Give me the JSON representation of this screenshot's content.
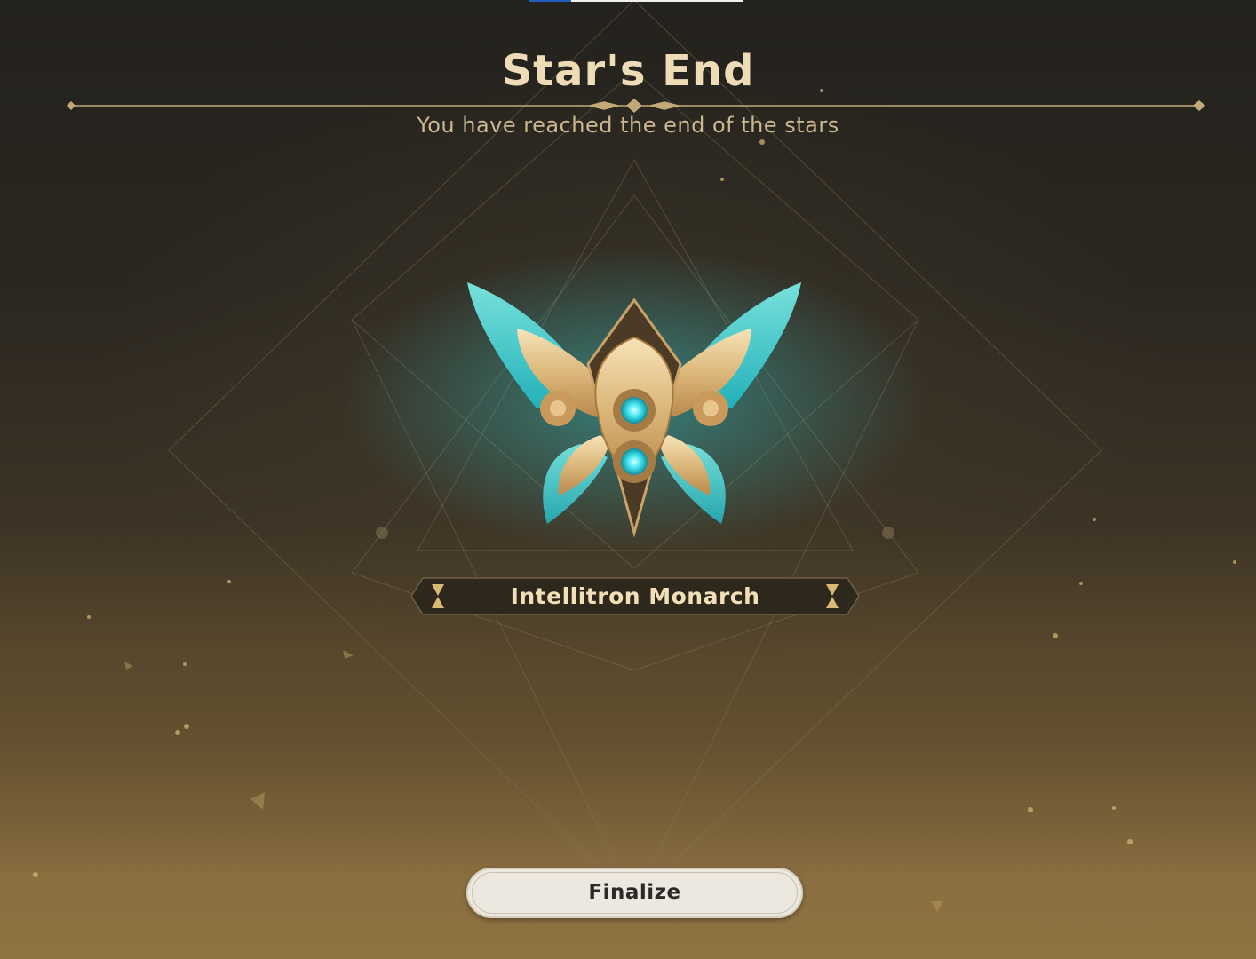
{
  "header": {
    "title": "Star's End",
    "subtitle": "You have reached the end of the stars"
  },
  "emblem": {
    "name": "Intellitron Monarch",
    "icon": "butterfly-gear-emblem-icon"
  },
  "actions": {
    "finalize_label": "Finalize"
  },
  "colors": {
    "title": "#eedcb6",
    "accent_gold": "#d9b779",
    "accent_cyan": "#4fe6e3",
    "button_bg": "#ece8df"
  }
}
